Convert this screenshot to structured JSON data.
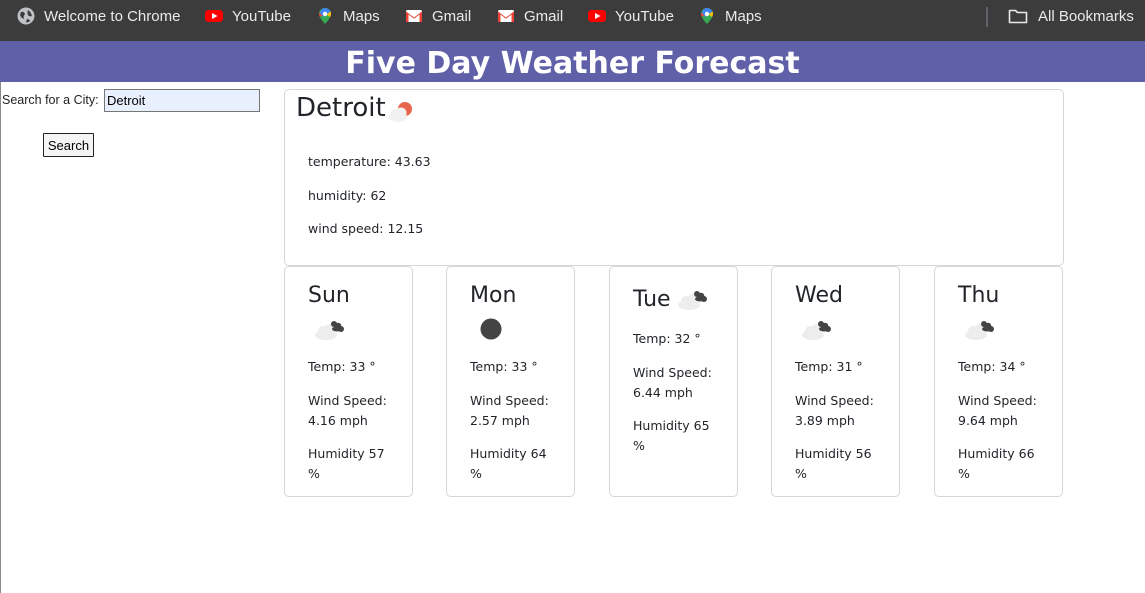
{
  "bookmarks": [
    {
      "label": "Welcome to Chrome",
      "icon": "chrome-globe-icon"
    },
    {
      "label": "YouTube",
      "icon": "youtube-icon"
    },
    {
      "label": "Maps",
      "icon": "maps-pin-icon"
    },
    {
      "label": "Gmail",
      "icon": "gmail-icon"
    },
    {
      "label": "Gmail",
      "icon": "gmail-icon"
    },
    {
      "label": "YouTube",
      "icon": "youtube-icon"
    },
    {
      "label": "Maps",
      "icon": "maps-pin-icon"
    }
  ],
  "all_bookmarks": {
    "label": "All Bookmarks",
    "icon": "folder-icon"
  },
  "header": {
    "title": "Five Day Weather Forecast"
  },
  "search": {
    "label": "Search for a City:",
    "value": "Detroit",
    "button": "Search"
  },
  "current": {
    "city": "Detroit",
    "icon": "partly-cloudy-sun-icon",
    "temperature": "temperature: 43.63",
    "humidity": "humidity: 62",
    "wind": "wind speed: 12.15"
  },
  "forecast": [
    {
      "day": "Sun",
      "icon": "cloudy-icon",
      "temp": "Temp: 33 °",
      "wind_label": "Wind Speed:",
      "wind_value": "4.16 mph",
      "humidity_label": "Humidity 57",
      "humidity_unit": "%"
    },
    {
      "day": "Mon",
      "icon": "dark-circle-icon",
      "temp": "Temp: 33 °",
      "wind_label": "Wind Speed:",
      "wind_value": "2.57 mph",
      "humidity_label": "Humidity 64",
      "humidity_unit": "%"
    },
    {
      "day": "Tue",
      "icon": "cloudy-icon",
      "temp": "Temp: 32 °",
      "wind_label": "Wind Speed:",
      "wind_value": "6.44 mph",
      "humidity_label": "Humidity 65",
      "humidity_unit": "%"
    },
    {
      "day": "Wed",
      "icon": "cloudy-icon",
      "temp": "Temp: 31 °",
      "wind_label": "Wind Speed:",
      "wind_value": "3.89 mph",
      "humidity_label": "Humidity 56",
      "humidity_unit": "%"
    },
    {
      "day": "Thu",
      "icon": "cloudy-icon",
      "temp": "Temp: 34 °",
      "wind_label": "Wind Speed:",
      "wind_value": "9.64 mph",
      "humidity_label": "Humidity 66",
      "humidity_unit": "%"
    }
  ],
  "colors": {
    "header_bg": "#6060a8",
    "bookmarks_bg": "#3c3c3c",
    "input_bg": "#e8f0fe"
  }
}
